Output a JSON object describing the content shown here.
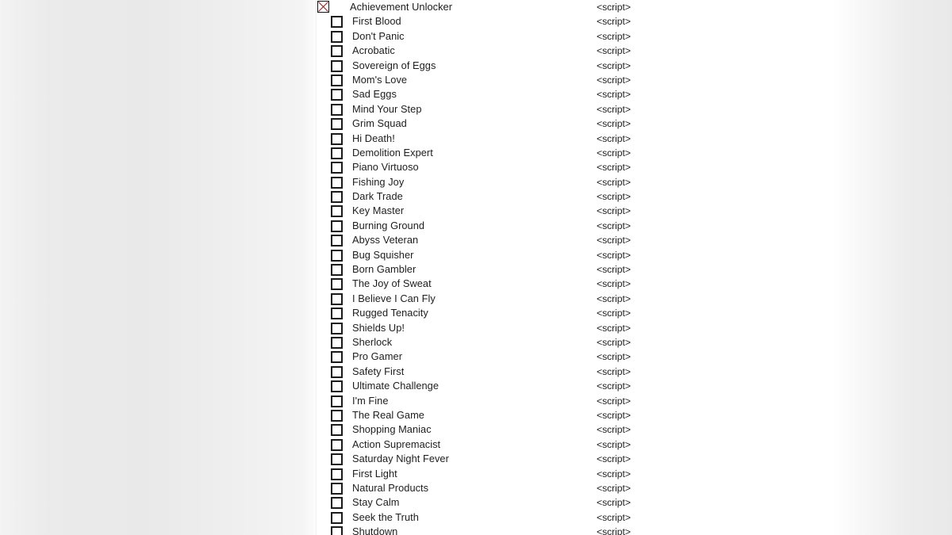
{
  "window": {
    "title": "Achievement Unlocker"
  },
  "header": {
    "label": "Achievement Unlocker",
    "checkbox_state": "crossed",
    "checkbox_icon": "checkbox-cross-icon",
    "script_label": "<script>"
  },
  "colors": {
    "text": "#1d1d1d",
    "checkbox_border": "#1b1b1b",
    "cross_mark": "#8c2322",
    "panel_background": "#ffffff",
    "page_background": "#ebebeb"
  },
  "list": {
    "script_label": "<script>",
    "checkbox_icon": "checkbox-unchecked-icon",
    "items": [
      {
        "label": "First Blood",
        "checked": false,
        "script": "<script>"
      },
      {
        "label": "Don't Panic",
        "checked": false,
        "script": "<script>"
      },
      {
        "label": "Acrobatic",
        "checked": false,
        "script": "<script>"
      },
      {
        "label": "Sovereign of Eggs",
        "checked": false,
        "script": "<script>"
      },
      {
        "label": "Mom's Love",
        "checked": false,
        "script": "<script>"
      },
      {
        "label": "Sad Eggs",
        "checked": false,
        "script": "<script>"
      },
      {
        "label": "Mind Your Step",
        "checked": false,
        "script": "<script>"
      },
      {
        "label": "Grim Squad",
        "checked": false,
        "script": "<script>"
      },
      {
        "label": "Hi Death!",
        "checked": false,
        "script": "<script>"
      },
      {
        "label": "Demolition Expert",
        "checked": false,
        "script": "<script>"
      },
      {
        "label": "Piano Virtuoso",
        "checked": false,
        "script": "<script>"
      },
      {
        "label": "Fishing Joy",
        "checked": false,
        "script": "<script>"
      },
      {
        "label": "Dark Trade",
        "checked": false,
        "script": "<script>"
      },
      {
        "label": "Key Master",
        "checked": false,
        "script": "<script>"
      },
      {
        "label": "Burning Ground",
        "checked": false,
        "script": "<script>"
      },
      {
        "label": "Abyss Veteran",
        "checked": false,
        "script": "<script>"
      },
      {
        "label": "Bug Squisher",
        "checked": false,
        "script": "<script>"
      },
      {
        "label": "Born Gambler",
        "checked": false,
        "script": "<script>"
      },
      {
        "label": "The Joy of Sweat",
        "checked": false,
        "script": "<script>"
      },
      {
        "label": "I Believe I Can Fly",
        "checked": false,
        "script": "<script>"
      },
      {
        "label": "Rugged Tenacity",
        "checked": false,
        "script": "<script>"
      },
      {
        "label": "Shields Up!",
        "checked": false,
        "script": "<script>"
      },
      {
        "label": "Sherlock",
        "checked": false,
        "script": "<script>"
      },
      {
        "label": "Pro Gamer",
        "checked": false,
        "script": "<script>"
      },
      {
        "label": "Safety First",
        "checked": false,
        "script": "<script>"
      },
      {
        "label": "Ultimate Challenge",
        "checked": false,
        "script": "<script>"
      },
      {
        "label": "I'm Fine",
        "checked": false,
        "script": "<script>"
      },
      {
        "label": "The Real Game",
        "checked": false,
        "script": "<script>"
      },
      {
        "label": "Shopping Maniac",
        "checked": false,
        "script": "<script>"
      },
      {
        "label": "Action Supremacist",
        "checked": false,
        "script": "<script>"
      },
      {
        "label": "Saturday Night Fever",
        "checked": false,
        "script": "<script>"
      },
      {
        "label": "First Light",
        "checked": false,
        "script": "<script>"
      },
      {
        "label": "Natural Products",
        "checked": false,
        "script": "<script>"
      },
      {
        "label": "Stay Calm",
        "checked": false,
        "script": "<script>"
      },
      {
        "label": "Seek the Truth",
        "checked": false,
        "script": "<script>"
      },
      {
        "label": "Shutdown",
        "checked": false,
        "script": "<script>"
      }
    ]
  }
}
